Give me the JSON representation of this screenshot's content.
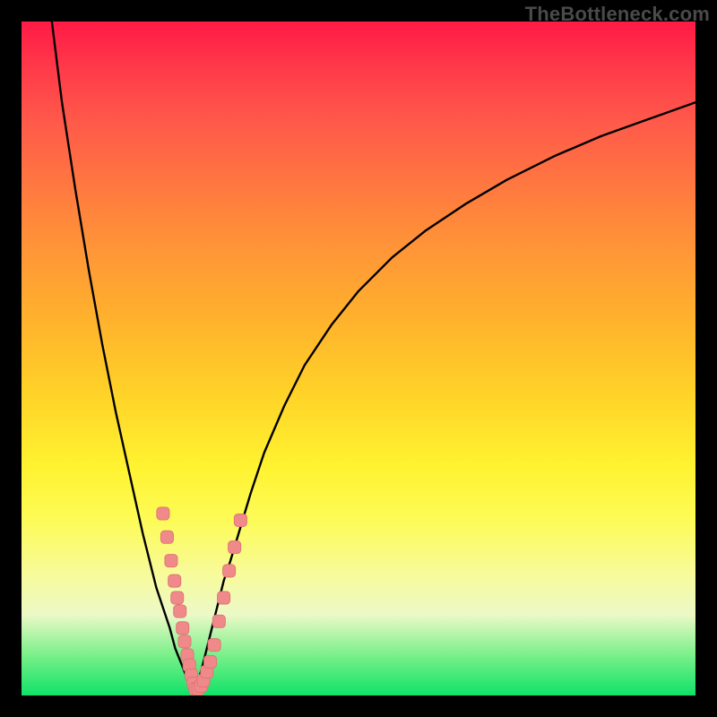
{
  "watermark": "TheBottleneck.com",
  "chart_data": {
    "type": "line",
    "title": "",
    "xlabel": "",
    "ylabel": "",
    "xlim": [
      0,
      100
    ],
    "ylim": [
      0,
      100
    ],
    "grid": false,
    "legend": false,
    "colors": {
      "gradient_top": "#ff1a45",
      "gradient_bottom": "#0fe268",
      "curve": "#000000",
      "marker_fill": "#f08a8a",
      "marker_stroke": "#e07575"
    },
    "series": [
      {
        "name": "left-branch",
        "x": [
          4.5,
          6,
          8,
          10,
          12,
          14,
          16,
          18,
          19,
          20,
          21,
          22,
          22.8,
          23.6,
          24.4,
          25.2,
          25.6
        ],
        "y": [
          100,
          88,
          75,
          63,
          52,
          42,
          33,
          24,
          20,
          16,
          13,
          10,
          7,
          5,
          3,
          1.5,
          0.5
        ]
      },
      {
        "name": "right-branch",
        "x": [
          25.6,
          26.2,
          27,
          28,
          29,
          30,
          31,
          32.5,
          34,
          36,
          39,
          42,
          46,
          50,
          55,
          60,
          66,
          72,
          79,
          86,
          93,
          100
        ],
        "y": [
          0.5,
          2,
          5,
          9,
          13,
          17,
          20,
          25,
          30,
          36,
          43,
          49,
          55,
          60,
          65,
          69,
          73,
          76.5,
          80,
          83,
          85.5,
          88
        ]
      }
    ],
    "markers": {
      "name": "highlighted-points",
      "shape": "square",
      "points": [
        {
          "x": 21.0,
          "y": 27.0
        },
        {
          "x": 21.6,
          "y": 23.5
        },
        {
          "x": 22.2,
          "y": 20.0
        },
        {
          "x": 22.7,
          "y": 17.0
        },
        {
          "x": 23.1,
          "y": 14.5
        },
        {
          "x": 23.5,
          "y": 12.5
        },
        {
          "x": 23.9,
          "y": 10.0
        },
        {
          "x": 24.2,
          "y": 8.0
        },
        {
          "x": 24.6,
          "y": 6.0
        },
        {
          "x": 24.9,
          "y": 4.5
        },
        {
          "x": 25.2,
          "y": 3.0
        },
        {
          "x": 25.5,
          "y": 1.8
        },
        {
          "x": 25.8,
          "y": 1.0
        },
        {
          "x": 26.2,
          "y": 1.0
        },
        {
          "x": 26.6,
          "y": 1.4
        },
        {
          "x": 27.0,
          "y": 2.2
        },
        {
          "x": 27.5,
          "y": 3.5
        },
        {
          "x": 28.0,
          "y": 5.0
        },
        {
          "x": 28.6,
          "y": 7.5
        },
        {
          "x": 29.3,
          "y": 11.0
        },
        {
          "x": 30.0,
          "y": 14.5
        },
        {
          "x": 30.8,
          "y": 18.5
        },
        {
          "x": 31.6,
          "y": 22.0
        },
        {
          "x": 32.5,
          "y": 26.0
        }
      ]
    }
  }
}
